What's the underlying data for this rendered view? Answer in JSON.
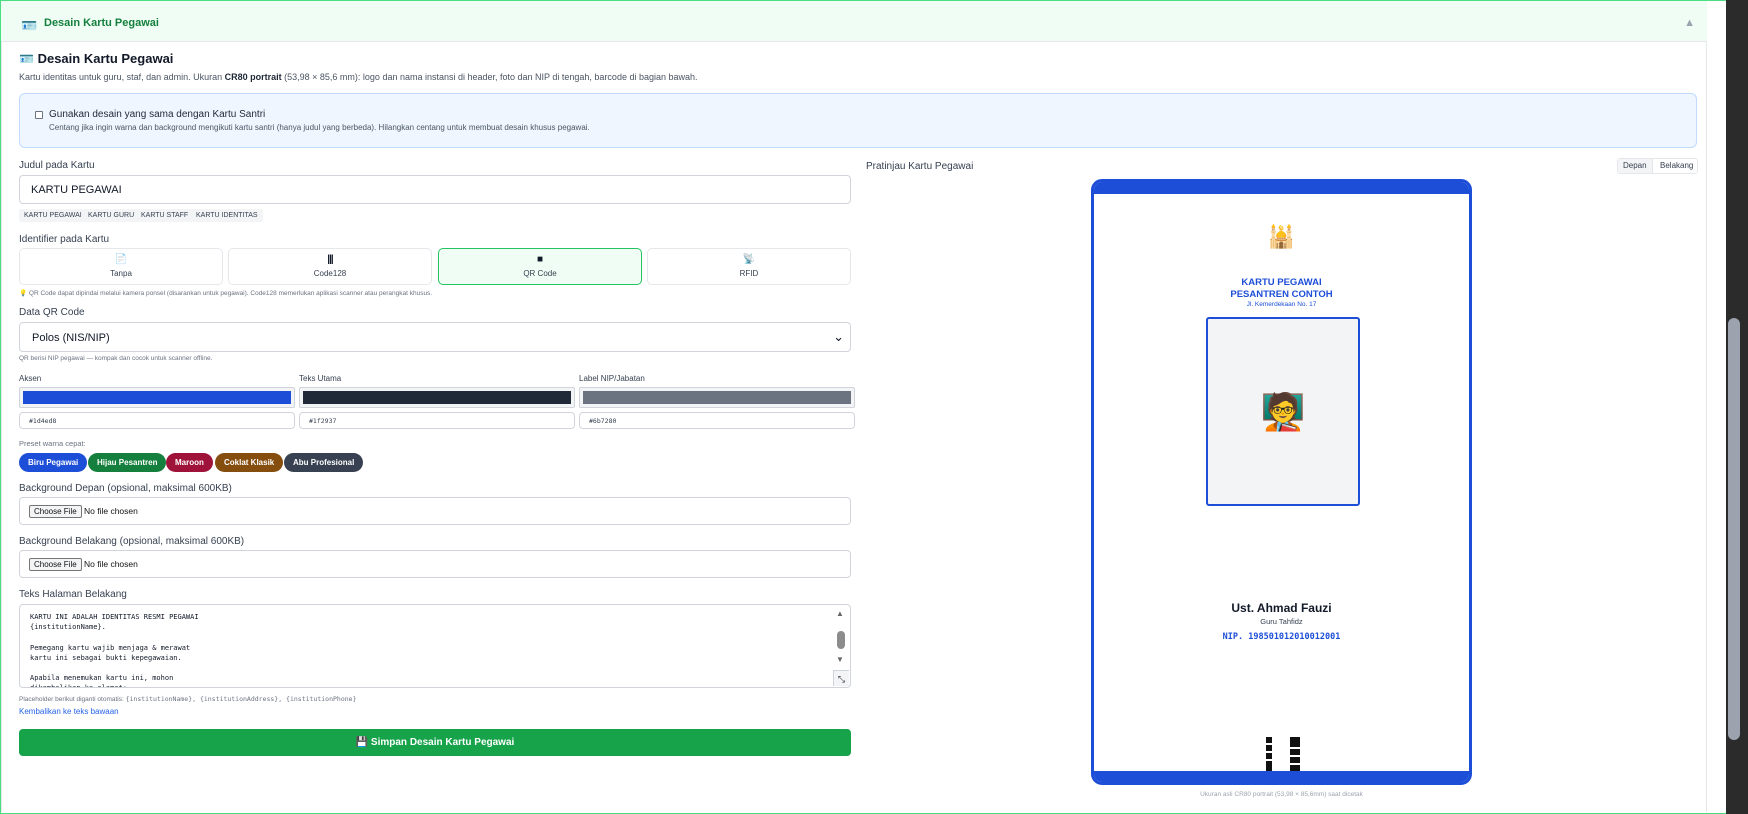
{
  "panel": {
    "title": "Desain Kartu Pegawai",
    "collapse_glyph": "▲"
  },
  "section": {
    "title": "Desain Kartu Pegawai",
    "desc_prefix": "Kartu identitas untuk guru, staf, dan admin. Ukuran ",
    "desc_bold": "CR80 portrait",
    "desc_suffix": " (53,98 × 85,6 mm): logo dan nama instansi di header, foto dan NIP di tengah, barcode di bagian bawah."
  },
  "same_design": {
    "label": "Gunakan desain yang sama dengan Kartu Santri",
    "help": "Centang jika ingin warna dan background mengikuti kartu santri (hanya judul yang berbeda). Hilangkan centang untuk membuat desain khusus pegawai.",
    "checked": false
  },
  "title_field": {
    "label": "Judul pada Kartu",
    "value": "KARTU PEGAWAI",
    "suggestions": [
      "KARTU PEGAWAI",
      "KARTU GURU",
      "KARTU STAFF",
      "KARTU IDENTITAS"
    ]
  },
  "identifier": {
    "label": "Identifier pada Kartu",
    "options": [
      {
        "label": "Tanpa",
        "icon": "📄"
      },
      {
        "label": "Code128",
        "icon": "|||"
      },
      {
        "label": "QR Code",
        "icon": "■"
      },
      {
        "label": "RFID",
        "icon": "📡"
      }
    ],
    "selected": "QR Code",
    "note": "💡 QR Code dapat dipindai melalui kamera ponsel (disarankan untuk pegawai). Code128 memerlukan aplikasi scanner atau perangkat khusus."
  },
  "qr_data": {
    "label": "Data QR Code",
    "value": "Polos (NIS/NIP)",
    "note": "QR berisi NIP pegawai — kompak dan cocok untuk scanner offline."
  },
  "colors": {
    "accent": {
      "label": "Aksen",
      "hex": "#1d4ed8"
    },
    "text_main": {
      "label": "Teks Utama",
      "hex": "#1f2937"
    },
    "nip_label": {
      "label": "Label NIP/Jabatan",
      "hex": "#6b7280"
    }
  },
  "presets": {
    "label": "Preset warna cepat:",
    "items": [
      {
        "label": "Biru Pegawai",
        "color": "#1d4ed8"
      },
      {
        "label": "Hijau Pesantren",
        "color": "#15803d"
      },
      {
        "label": "Maroon",
        "color": "#9f1239"
      },
      {
        "label": "Coklat Klasik",
        "color": "#854d0e"
      },
      {
        "label": "Abu Profesional",
        "color": "#374151"
      }
    ]
  },
  "bg_front": {
    "label": "Background Depan (opsional, maksimal 600KB)",
    "button": "Choose File",
    "status": "No file chosen"
  },
  "bg_back": {
    "label": "Background Belakang (opsional, maksimal 600KB)",
    "button": "Choose File",
    "status": "No file chosen"
  },
  "back_text": {
    "label": "Teks Halaman Belakang",
    "value": "KARTU INI ADALAH IDENTITAS RESMI PEGAWAI\n{institutionName}.\n\nPemegang kartu wajib menjaga & merawat\nkartu ini sebagai bukti kepegawaian.\n\nApabila menemukan kartu ini, mohon\ndikembalikan ke alamat:",
    "placeholder_note_prefix": "Placeholder berikut diganti otomatis: ",
    "placeholder_tokens": "{institutionName}, {institutionAddress}, {institutionPhone}",
    "reset_link": "Kembalikan ke teks bawaan"
  },
  "save_button": "💾 Simpan Desain Kartu Pegawai",
  "preview": {
    "title": "Pratinjau Kartu Pegawai",
    "tabs": [
      "Depan",
      "Belakang"
    ],
    "active_tab": "Depan",
    "card": {
      "logo": "🕌",
      "title_line1": "KARTU PEGAWAI",
      "title_line2": "PESANTREN CONTOH",
      "address": "Jl. Kemerdekaan No. 17",
      "avatar": "🧑‍🏫",
      "name": "Ust. Ahmad Fauzi",
      "role": "Guru Tahfidz",
      "nip": "NIP. 198501012010012001",
      "accent": "#1d4ed8"
    },
    "caption": "Ukuran asli CR80 portrait (53,98 × 85,6mm) saat dicetak"
  }
}
